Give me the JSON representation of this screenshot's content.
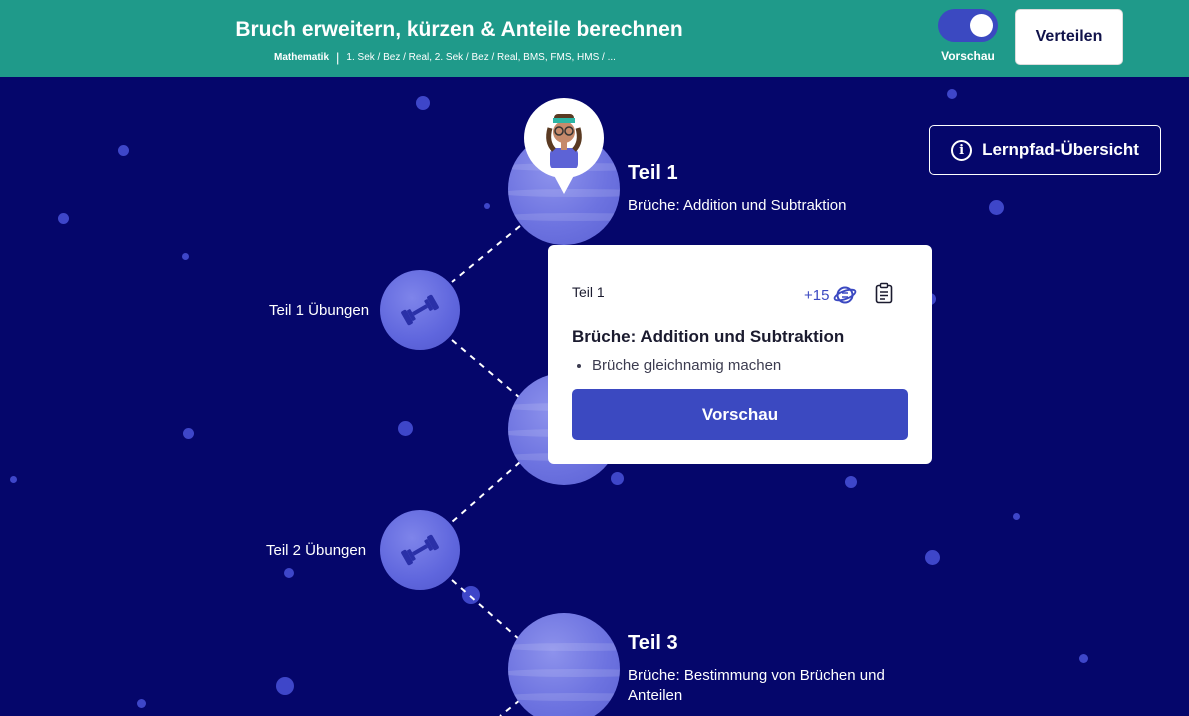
{
  "header": {
    "title": "Bruch erweitern, kürzen & Anteile berechnen",
    "subject": "Mathematik",
    "separator": "|",
    "levels": "1. Sek / Bez / Real, 2. Sek / Bez / Real, BMS, FMS, HMS / ...",
    "preview_label": "Vorschau",
    "preview_toggle_on": true,
    "share_label": "Verteilen"
  },
  "overview_button": {
    "label": "Lernpfad-Übersicht",
    "icon": "info-icon"
  },
  "nodes": {
    "teil1": {
      "title": "Teil 1",
      "subtitle": "Brüche: Addition und Subtraktion"
    },
    "ex1": {
      "label": "Teil 1 Übungen",
      "icon": "dumbbell-icon"
    },
    "ex2": {
      "label": "Teil 2 Übungen",
      "icon": "dumbbell-icon"
    },
    "teil3": {
      "title": "Teil 3",
      "subtitle_line1": "Brüche: Bestimmung von Brüchen und",
      "subtitle_line2": "Anteilen"
    }
  },
  "popup": {
    "part": "Teil 1",
    "points": "+15",
    "heading": "Brüche: Addition und Subtraktion",
    "topics": [
      "Brüche gleichnamig machen"
    ],
    "button": "Vorschau"
  },
  "colors": {
    "header_bg": "#1f9a8a",
    "map_bg": "#05066b",
    "accent": "#3b49c1",
    "planet": "#6d73e0"
  }
}
